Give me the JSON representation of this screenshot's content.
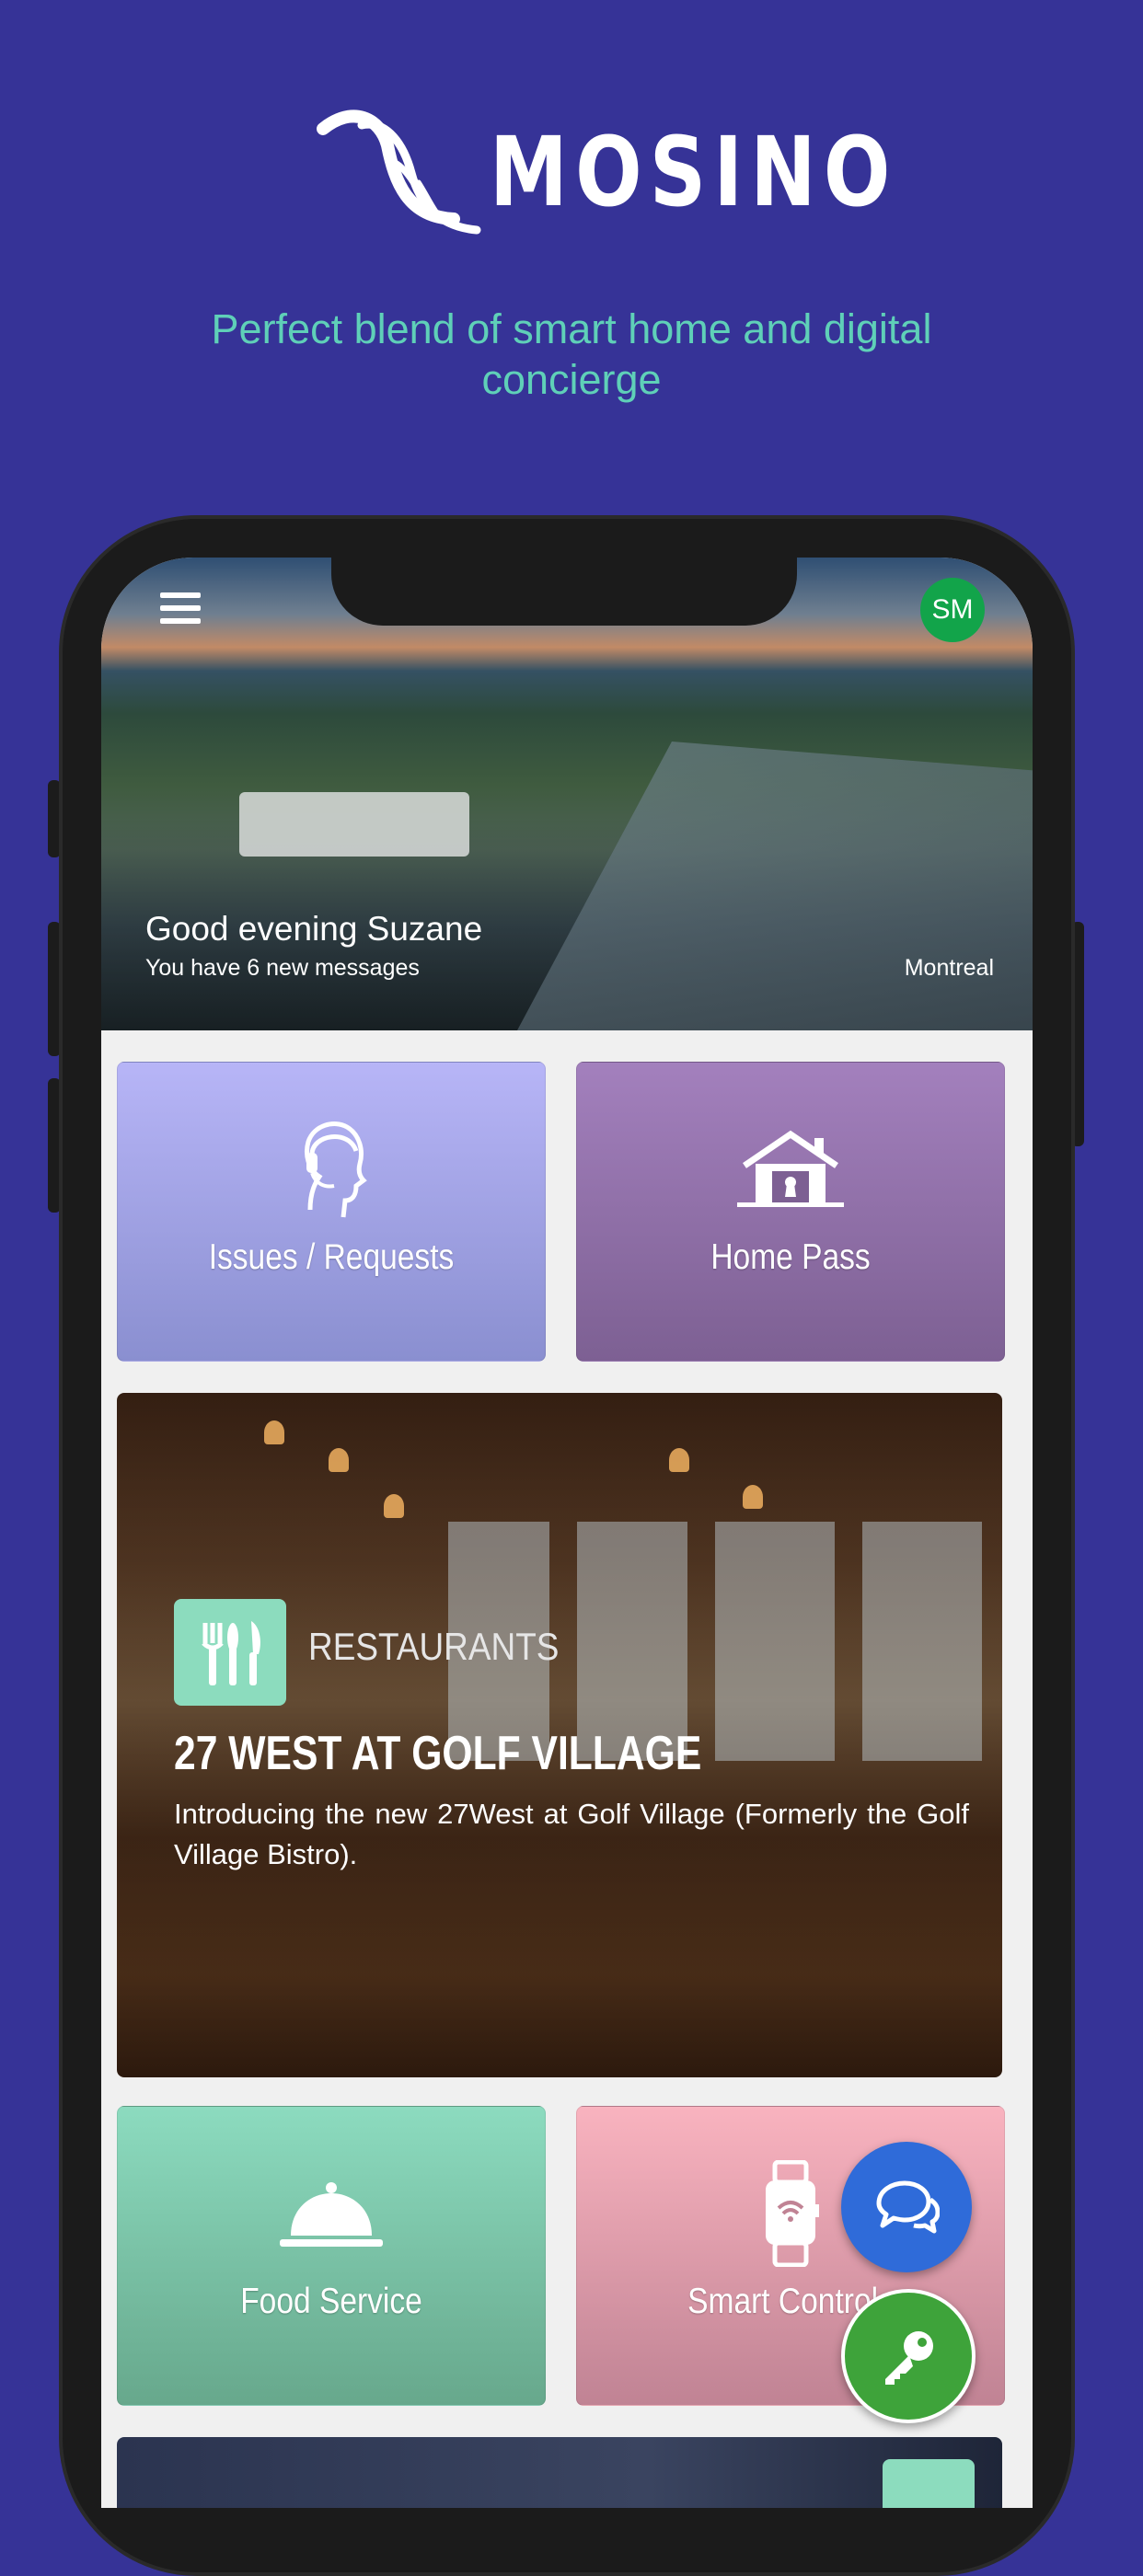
{
  "brand": {
    "name": "MOSINO",
    "tagline": "Perfect blend of smart home and digital concierge"
  },
  "app": {
    "avatar_initials": "SM",
    "greeting": "Good evening Suzane",
    "messages": "You have 6 new messages",
    "location": "Montreal",
    "tiles": {
      "issues": "Issues / Requests",
      "home_pass": "Home Pass",
      "food": "Food Service",
      "smart": "Smart Controls"
    },
    "feature": {
      "category": "RESTAURANTS",
      "title": "27 WEST AT GOLF VILLAGE",
      "description": "Introducing the new 27West at Golf Village (Formerly the Golf Village Bistro)."
    },
    "icons": {
      "menu": "hamburger-menu-icon",
      "issues": "headset-support-icon",
      "home_pass": "house-keyhole-icon",
      "restaurant": "fork-knife-icon",
      "food": "serving-cloche-icon",
      "smart": "smartwatch-wifi-icon",
      "chat": "chat-bubbles-icon",
      "key": "key-icon"
    },
    "colors": {
      "background": "#363397",
      "tagline": "#5fd0b8",
      "avatar": "#12a44a",
      "chat_fab": "#2f6bd9",
      "key_fab": "#3ea33a"
    }
  }
}
